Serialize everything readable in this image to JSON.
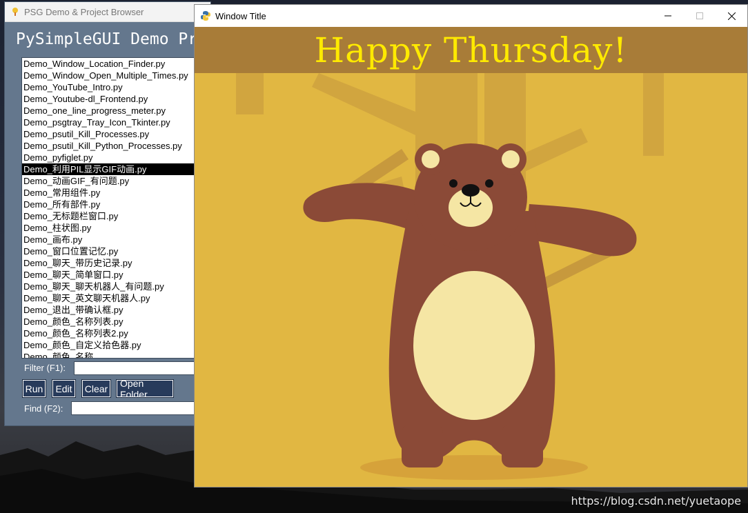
{
  "psg_window": {
    "title": "PSG Demo & Project Browser",
    "heading": "PySimpleGUI Demo Pr",
    "files": [
      "Demo_Window_Location_Finder.py",
      "Demo_Window_Open_Multiple_Times.py",
      "Demo_YouTube_Intro.py",
      "Demo_Youtube-dl_Frontend.py",
      "Demo_one_line_progress_meter.py",
      "Demo_psgtray_Tray_Icon_Tkinter.py",
      "Demo_psutil_Kill_Processes.py",
      "Demo_psutil_Kill_Python_Processes.py",
      "Demo_pyfiglet.py",
      "Demo_利用PIL显示GIF动画.py",
      "Demo_动画GIF_有问题.py",
      "Demo_常用组件.py",
      "Demo_所有部件.py",
      "Demo_无标题栏窗口.py",
      "Demo_柱状图.py",
      "Demo_画布.py",
      "Demo_窗口位置记忆.py",
      "Demo_聊天_带历史记录.py",
      "Demo_聊天_简单窗口.py",
      "Demo_聊天_聊天机器人_有问题.py",
      "Demo_聊天_英文聊天机器人.py",
      "Demo_退出_带确认框.py",
      "Demo_颜色_名称列表.py",
      "Demo_颜色_名称列表2.py",
      "Demo_颜色_自定义拾色器.py",
      "Demo_颜色_名称"
    ],
    "selected_index": 9,
    "filter_label": "Filter (F1):",
    "filter_value": "",
    "find_label": "Find (F2):",
    "find_value": "",
    "buttons": {
      "run": "Run",
      "edit": "Edit",
      "clear": "Clear",
      "open_folder": "Open Folder"
    }
  },
  "gif_window": {
    "title": "Window Title",
    "banner_text": "Happy Thursday!",
    "banner_color": "#a87c38",
    "banner_text_color": "#ffea00",
    "background_color": "#e1b742"
  },
  "watermark": "https://blog.csdn.net/yuetaope"
}
